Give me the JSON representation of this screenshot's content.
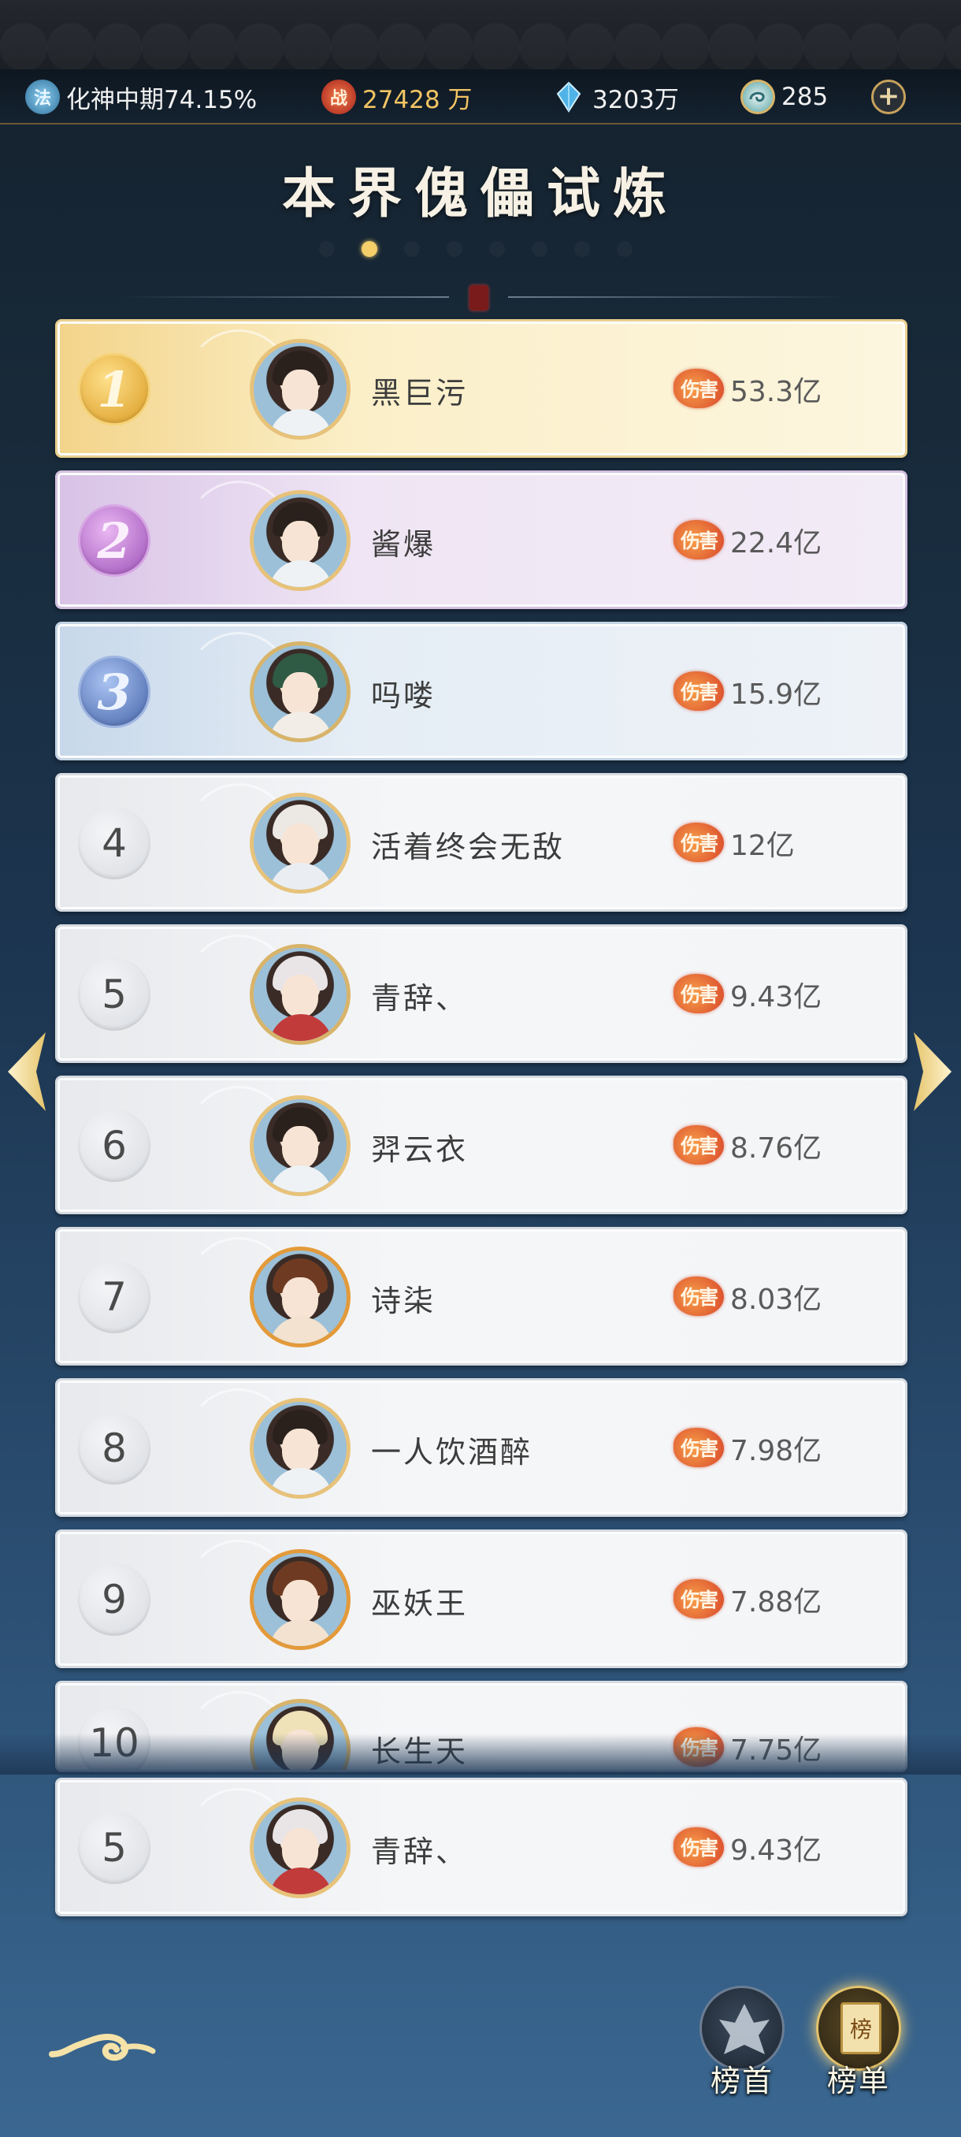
{
  "header": {
    "realm": {
      "icon": "法",
      "text": "化神中期74.15%"
    },
    "power": {
      "icon": "战",
      "text": "27428 万"
    },
    "crystal": {
      "text": "3203万"
    },
    "coin": {
      "text": "285"
    },
    "plus_label": "+"
  },
  "title": "本界傀儡试炼",
  "pagination": {
    "total": 8,
    "active_index": 1
  },
  "seal_label": "",
  "damage_label": "伤害",
  "colors": {
    "gold_accent": "#f2c463",
    "active_dot": "#f4cf6a",
    "damage_badge": "#d8442a"
  },
  "ranks": [
    {
      "rank": "1",
      "name": "黑巨污",
      "damage": "53.3亿",
      "tier": "gold",
      "avatar": "young-man-dark-hair"
    },
    {
      "rank": "2",
      "name": "酱爆",
      "damage": "22.4亿",
      "tier": "purple",
      "avatar": "young-man-dark-hair"
    },
    {
      "rank": "3",
      "name": "吗喽",
      "damage": "15.9亿",
      "tier": "blue",
      "avatar": "girl-green-hair"
    },
    {
      "rank": "4",
      "name": "活着终会无敌",
      "damage": "12亿",
      "tier": "plain",
      "avatar": "girl-white-hair"
    },
    {
      "rank": "5",
      "name": "青辞、",
      "damage": "9.43亿",
      "tier": "plain",
      "avatar": "girl-white-red"
    },
    {
      "rank": "6",
      "name": "羿云衣",
      "damage": "8.76亿",
      "tier": "plain",
      "avatar": "young-man-dark-hair"
    },
    {
      "rank": "7",
      "name": "诗柒",
      "damage": "8.03亿",
      "tier": "plain",
      "avatar": "girl-brown-hair"
    },
    {
      "rank": "8",
      "name": "一人饮酒醉",
      "damage": "7.98亿",
      "tier": "plain",
      "avatar": "young-man-dark-hair"
    },
    {
      "rank": "9",
      "name": "巫妖王",
      "damage": "7.88亿",
      "tier": "plain",
      "avatar": "girl-brown-hair"
    },
    {
      "rank": "10",
      "name": "长生天",
      "damage": "7.75亿",
      "tier": "plain",
      "avatar": "girl-blonde-hair"
    }
  ],
  "my_rank": {
    "rank": "5",
    "name": "青辞、",
    "damage": "9.43亿",
    "avatar": "girl-white-red"
  },
  "nav": {
    "prev_icon": "chevron-left-icon",
    "next_icon": "chevron-right-icon"
  },
  "bottom": {
    "top_rank_label": "榜首",
    "leaderboard_label": "榜单",
    "leaderboard_badge": "榜"
  }
}
